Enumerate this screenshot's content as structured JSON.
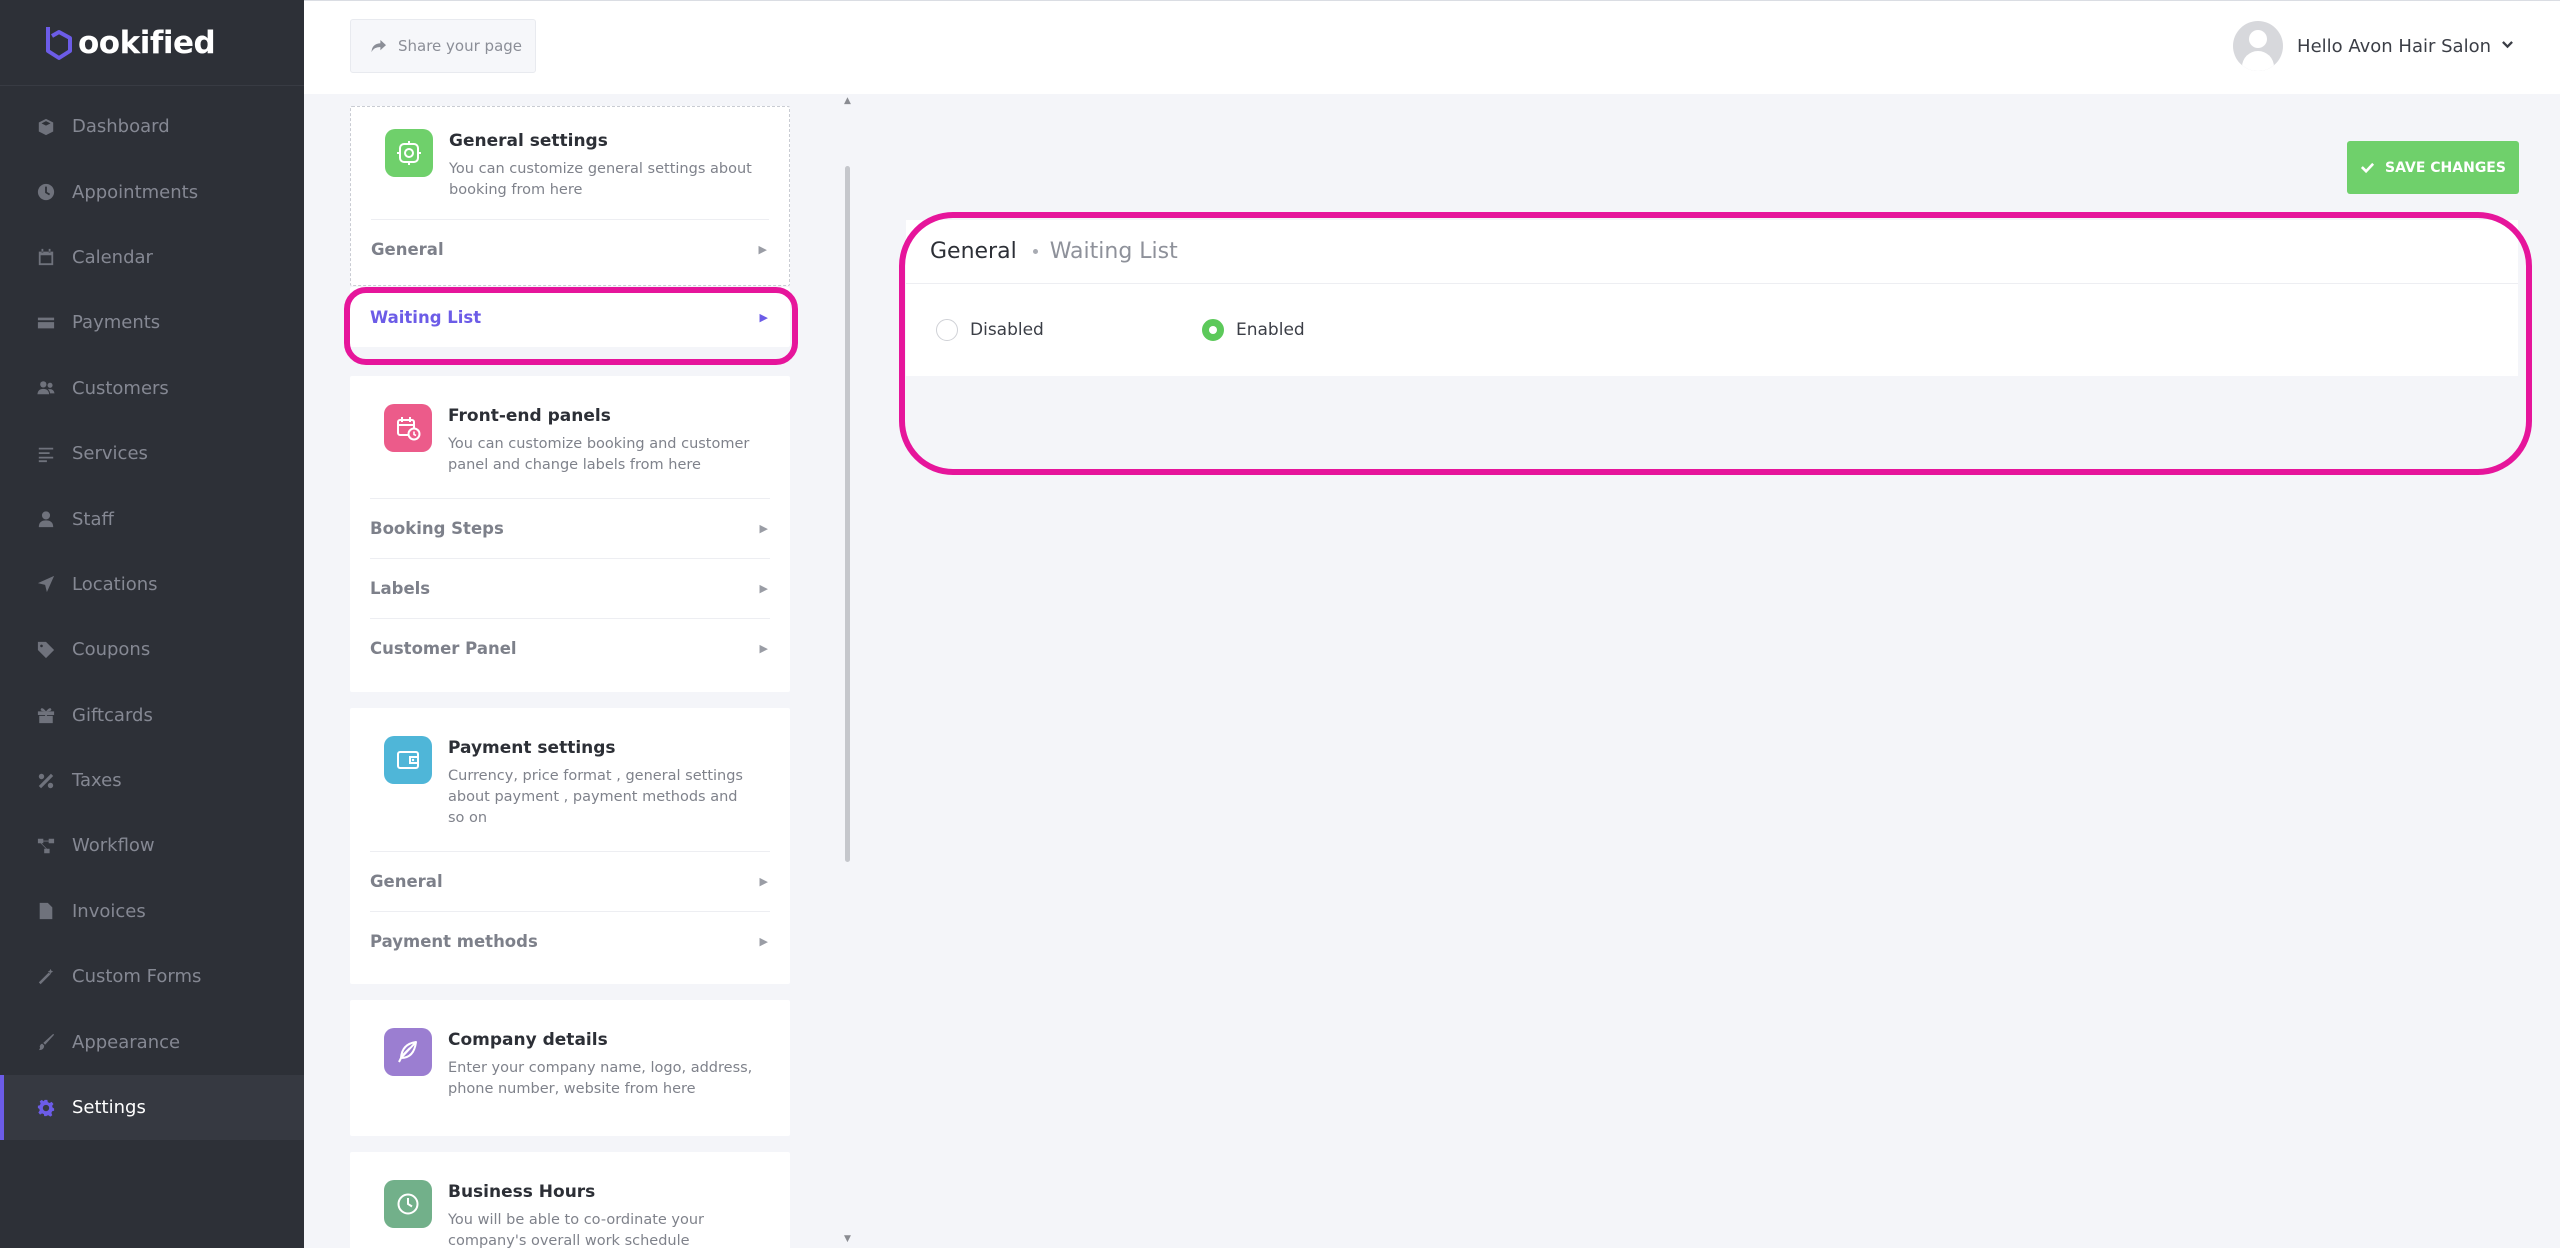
{
  "brand": {
    "name": "ookified",
    "mark_color": "#6c5ce7"
  },
  "sidebar": {
    "items": [
      {
        "label": "Dashboard",
        "icon": "cube-icon"
      },
      {
        "label": "Appointments",
        "icon": "clock-icon"
      },
      {
        "label": "Calendar",
        "icon": "calendar-icon"
      },
      {
        "label": "Payments",
        "icon": "credit-card-icon"
      },
      {
        "label": "Customers",
        "icon": "users-icon"
      },
      {
        "label": "Services",
        "icon": "list-icon"
      },
      {
        "label": "Staff",
        "icon": "user-icon"
      },
      {
        "label": "Locations",
        "icon": "location-arrow-icon"
      },
      {
        "label": "Coupons",
        "icon": "tag-icon"
      },
      {
        "label": "Giftcards",
        "icon": "gift-icon"
      },
      {
        "label": "Taxes",
        "icon": "percent-icon"
      },
      {
        "label": "Workflow",
        "icon": "workflow-icon"
      },
      {
        "label": "Invoices",
        "icon": "file-icon"
      },
      {
        "label": "Custom Forms",
        "icon": "magic-wand-icon"
      },
      {
        "label": "Appearance",
        "icon": "brush-icon"
      },
      {
        "label": "Settings",
        "icon": "cog-icon",
        "active": true
      }
    ]
  },
  "topbar": {
    "share_label": "Share your page",
    "user_greeting": "Hello Avon Hair Salon"
  },
  "settings_groups": [
    {
      "title": "General settings",
      "description": "You can customize general settings about booking from here",
      "icon": "gear-icon",
      "color": "#6fd06b",
      "items": [
        "General",
        "Waiting List"
      ],
      "selected": "Waiting List"
    },
    {
      "title": "Front-end panels",
      "description": "You can customize booking and customer panel and change labels from here",
      "icon": "calendar-clock-icon",
      "color": "#ec5b8a",
      "items": [
        "Booking Steps",
        "Labels",
        "Customer Panel"
      ]
    },
    {
      "title": "Payment settings",
      "description": "Currency, price format , general settings about payment , payment methods and so on",
      "icon": "wallet-icon",
      "color": "#4fb6d8",
      "items": [
        "General",
        "Payment methods"
      ]
    },
    {
      "title": "Company details",
      "description": "Enter your company name, logo, address, phone number, website from here",
      "icon": "feather-icon",
      "color": "#9b7ed1",
      "items": []
    },
    {
      "title": "Business Hours",
      "description": "You will be able to co-ordinate your company's overall work schedule",
      "icon": "clock-icon",
      "color": "#72b08a",
      "items": []
    }
  ],
  "main": {
    "save_label": "SAVE CHANGES",
    "save_color": "#6fd06b",
    "breadcrumb": {
      "parent": "General",
      "current": "Waiting List"
    },
    "options": [
      {
        "label": "Disabled",
        "checked": false
      },
      {
        "label": "Enabled",
        "checked": true
      }
    ]
  },
  "highlight_color": "#e6159b"
}
